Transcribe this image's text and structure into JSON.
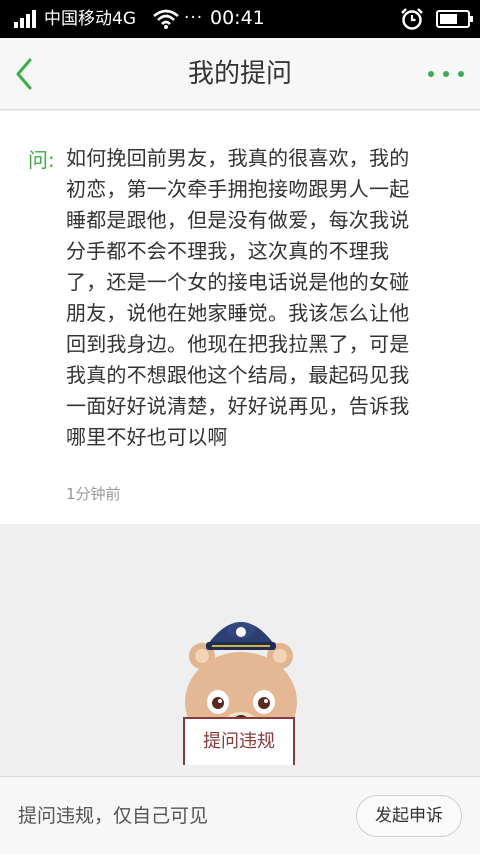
{
  "status_bar": {
    "carrier": "中国移动4G",
    "extra_dots": "···",
    "time": "00:41",
    "battery_level": 0.7,
    "icons": [
      "signal-icon",
      "wifi-icon",
      "alarm-icon",
      "battery-icon"
    ]
  },
  "nav": {
    "title": "我的提问",
    "back_icon": "chevron-left-icon",
    "more_icon": "more-dots-icon",
    "accent_color": "#3aae49"
  },
  "question": {
    "label": "问:",
    "lines": [
      "如何挽回前男友，我真的很喜欢，我的",
      "初恋，第一次牵手拥抱接吻跟男人一起",
      "睡都是跟他，但是没有做爱，每次我说",
      "分手都不会不理我，这次真的不理我",
      "了，还是一个女的接电话说是他的女碰",
      "朋友，说他在她家睡觉。我该怎么让他",
      "回到我身边。他现在把我拉黑了，可是",
      "我真的不想跟他这个结局，最起码见我",
      "一面好好说清楚，好好说再见，告诉我",
      "哪里不好也可以啊"
    ],
    "time": "1分钟前"
  },
  "violation": {
    "mascot_icon": "police-bear-icon",
    "sign_text": "提问违规"
  },
  "bottom_bar": {
    "notice": "提问违规，仅自己可见",
    "appeal_label": "发起申诉"
  }
}
